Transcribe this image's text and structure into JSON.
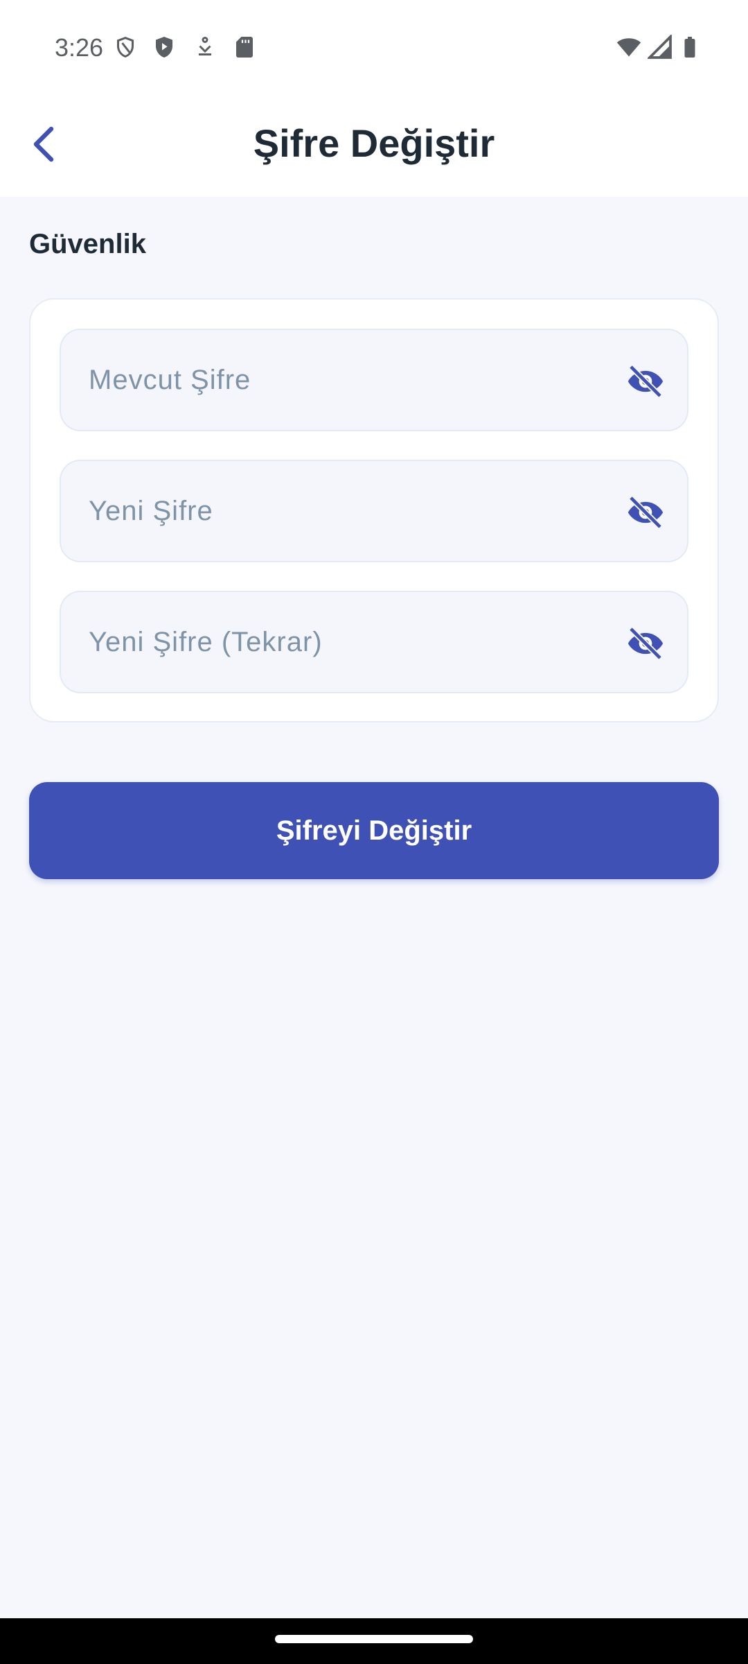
{
  "status_bar": {
    "time": "3:26",
    "left_icons": [
      "shield-outline-icon",
      "shield-play-icon",
      "download-icon",
      "sd-card-icon"
    ],
    "right_icons": [
      "wifi-icon",
      "cellular-signal-icon",
      "battery-icon"
    ]
  },
  "app_bar": {
    "back_icon": "chevron-left-icon",
    "title": "Şifre Değiştir"
  },
  "section": {
    "label": "Güvenlik"
  },
  "form": {
    "fields": [
      {
        "placeholder": "Mevcut Şifre",
        "value": "",
        "icon": "eye-off-icon"
      },
      {
        "placeholder": "Yeni Şifre",
        "value": "",
        "icon": "eye-off-icon"
      },
      {
        "placeholder": "Yeni Şifre (Tekrar)",
        "value": "",
        "icon": "eye-off-icon"
      }
    ],
    "submit_label": "Şifreyi Değiştir"
  },
  "colors": {
    "accent": "#3f51b5",
    "background": "#f5f7fc",
    "title_text": "#1f2a37",
    "placeholder_text": "#7e92a8"
  }
}
